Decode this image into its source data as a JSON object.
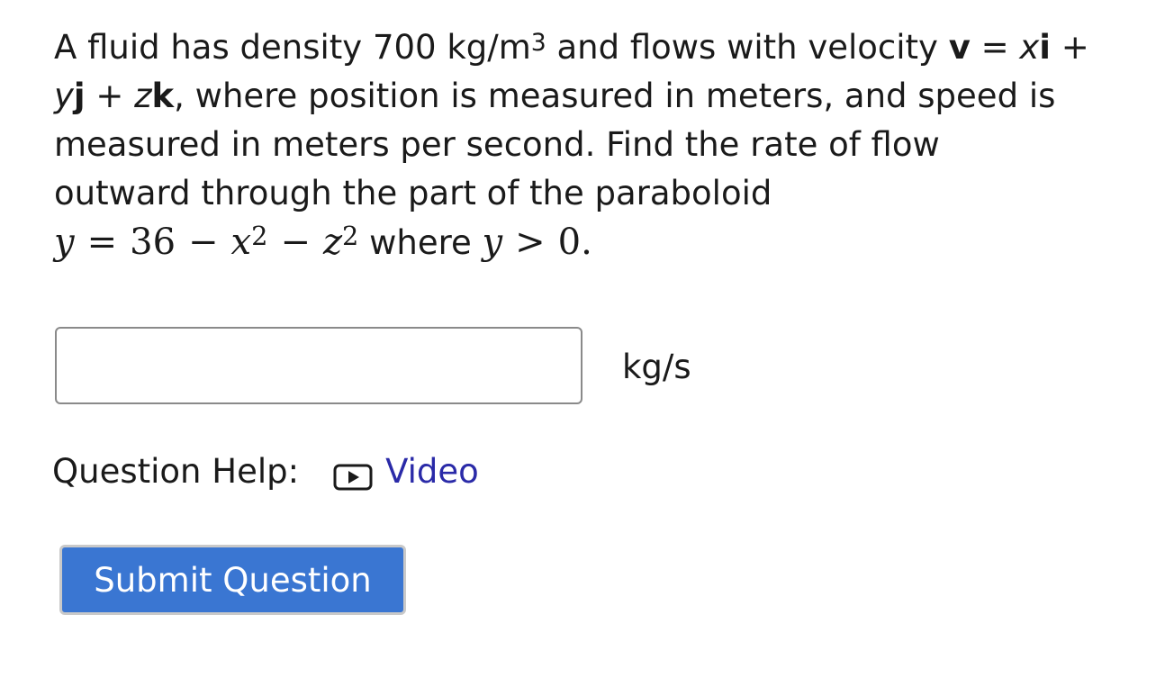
{
  "question": {
    "line1_pre": "A fluid has density 700 kg/m",
    "line1_sup": "3",
    "line1_mid": " and flows with velocity ",
    "vec_v": "v",
    "equals": " = ",
    "x": "x",
    "i": "i",
    "plus1": " +",
    "y": "y",
    "j": "j",
    "plus2": " + ",
    "z": "z",
    "k": "k",
    "line2_rest": ", where position is measured in meters, and speed is",
    "line3": "measured in meters per second. Find the rate of flow",
    "line4": "outward through the part of the paraboloid",
    "math": {
      "y": "y",
      "eq": "=",
      "c": "36",
      "minus1": "−",
      "x": "x",
      "x_exp": "2",
      "minus2": "−",
      "z": "z",
      "z_exp": "2",
      "where": " where ",
      "y2": "y",
      "gt": ">",
      "zero": "0."
    }
  },
  "answer": {
    "value": "",
    "unit": "kg/s"
  },
  "help": {
    "label": "Question Help:",
    "video_label": "Video",
    "video_icon": "play-icon"
  },
  "submit": {
    "label": "Submit Question"
  },
  "colors": {
    "link": "#2a2aa8",
    "button_bg": "#3a76d2",
    "button_text": "#ffffff"
  }
}
